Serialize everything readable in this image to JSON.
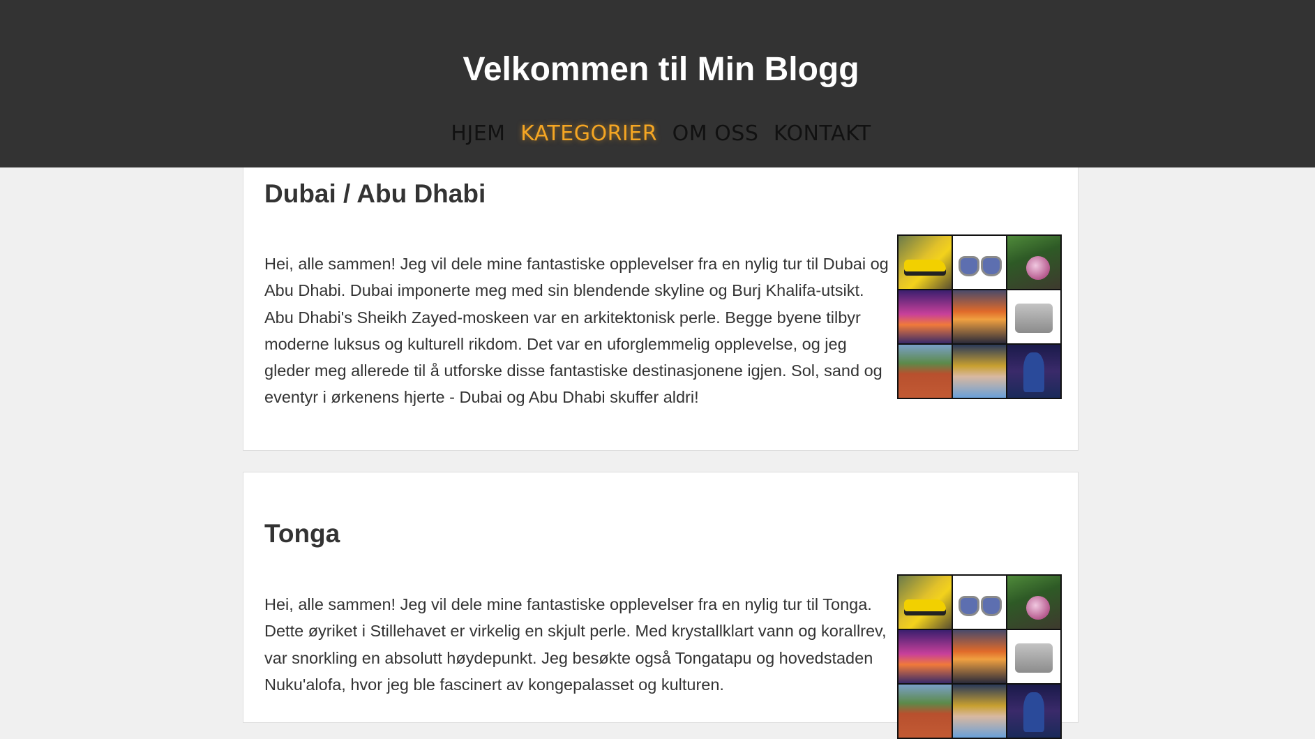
{
  "header": {
    "title": "Velkommen til Min Blogg",
    "nav": [
      {
        "label": "HJEM",
        "active": false
      },
      {
        "label": "KATEGORIER",
        "active": true
      },
      {
        "label": "OM OSS",
        "active": false
      },
      {
        "label": "KONTAKT",
        "active": false
      }
    ],
    "active_color": "#f5a623",
    "background_color": "#333333"
  },
  "posts": [
    {
      "title": "Dubai / Abu Dhabi",
      "text": "Hei, alle sammen! Jeg vil dele mine fantastiske opplevelser fra en nylig tur til Dubai og Abu Dhabi. Dubai imponerte meg med sin blendende skyline og Burj Khalifa-utsikt. Abu Dhabi's Sheikh Zayed-moskeen var en arkitektonisk perle. Begge byene tilbyr moderne luksus og kulturell rikdom. Det var en uforglemmelig opplevelse, og jeg gleder meg allerede til å utforske disse fantastiske destinasjonene igjen. Sol, sand og eventyr i ørkenens hjerte - Dubai og Abu Dhabi skuffer aldri!"
    },
    {
      "title": "Tonga",
      "text": "Hei, alle sammen! Jeg vil dele mine fantastiske opplevelser fra en nylig tur til Tonga. Dette øyriket i Stillehavet er virkelig en skjult perle. Med krystallklart vann og korallrev, var snorkling en absolutt høydepunkt. Jeg besøkte også Tongatapu og hovedstaden Nuku'alofa, hvor jeg ble fascinert av kongepalasset og kulturen."
    }
  ],
  "image_grid_tiles": [
    "yellow-car",
    "sunglasses",
    "radish",
    "sunset-pier",
    "sunset-sky",
    "gray-ottoman",
    "running-track",
    "player-trophy",
    "football-player"
  ]
}
